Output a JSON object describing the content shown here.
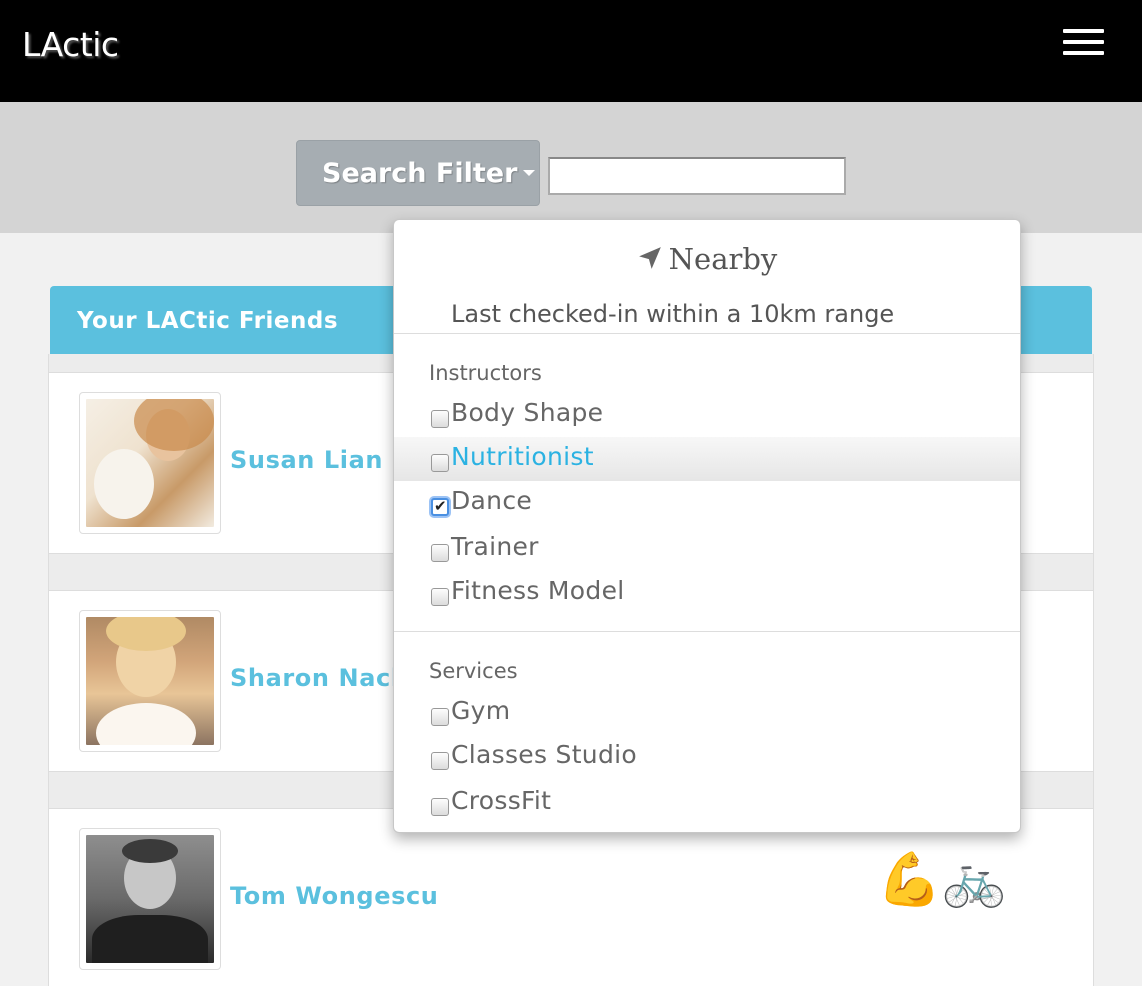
{
  "navbar": {
    "brand": "LActic",
    "menu_icon": "hamburger-menu-icon"
  },
  "search": {
    "filter_button_label": "Search Filter",
    "input_value": "",
    "input_placeholder": ""
  },
  "friends_panel": {
    "title": "Your LACtic Friends",
    "friends": [
      {
        "name": "Susan Lian",
        "icons": []
      },
      {
        "name": "Sharon Nach",
        "icons": []
      },
      {
        "name": "Tom Wongescu",
        "icons": [
          "💪",
          "🚲"
        ],
        "icon_names": [
          "flexed-biceps-icon",
          "bicycle-icon"
        ]
      }
    ]
  },
  "dropdown": {
    "nearby_icon": "location-arrow-icon",
    "nearby_label": "Nearby",
    "nearby_subtitle": "Last checked-in within a 10km range",
    "sections": [
      {
        "header": "Instructors",
        "options": [
          {
            "label": "Body Shape",
            "checked": false
          },
          {
            "label": "Nutritionist",
            "checked": false,
            "hovered": true
          },
          {
            "label": "Dance",
            "checked": true
          },
          {
            "label": "Trainer",
            "checked": false
          },
          {
            "label": "Fitness Model",
            "checked": false
          }
        ]
      },
      {
        "header": "Services",
        "options": [
          {
            "label": "Gym",
            "checked": false
          },
          {
            "label": "Classes Studio",
            "checked": false
          },
          {
            "label": "CrossFit",
            "checked": false
          }
        ]
      }
    ]
  },
  "colors": {
    "navbar_bg": "#000000",
    "accent": "#5bc0de",
    "filter_button": "#a6adb2",
    "hover_text": "#2bb2e2"
  }
}
